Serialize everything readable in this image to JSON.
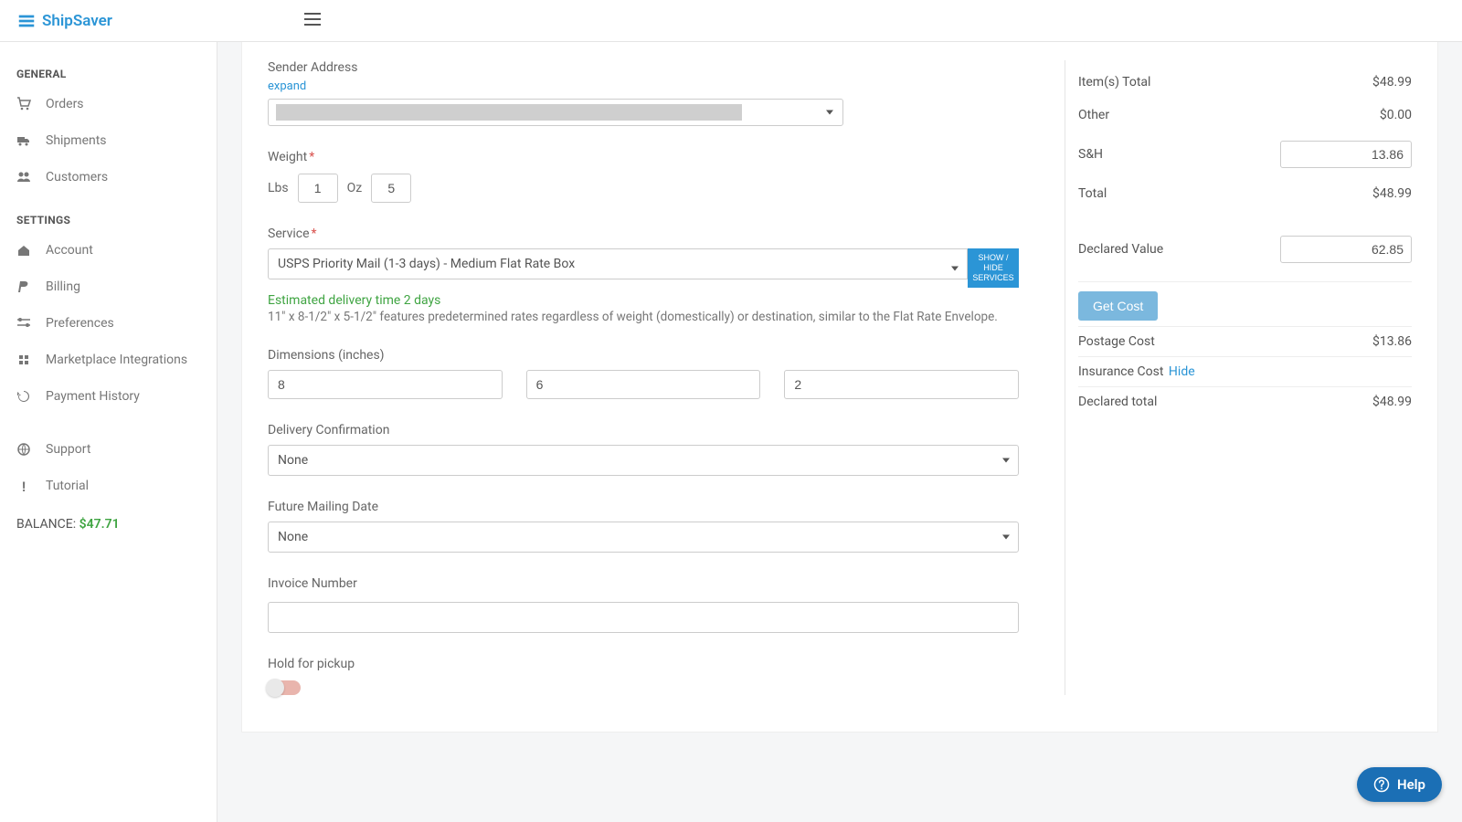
{
  "brand": "ShipSaver",
  "sidebar": {
    "general_heading": "GENERAL",
    "settings_heading": "SETTINGS",
    "items": {
      "orders": "Orders",
      "shipments": "Shipments",
      "customers": "Customers",
      "account": "Account",
      "billing": "Billing",
      "preferences": "Preferences",
      "integrations": "Marketplace Integrations",
      "payment_history": "Payment History",
      "support": "Support",
      "tutorial": "Tutorial"
    },
    "balance_label": "BALANCE:",
    "balance_amount": "$47.71"
  },
  "form": {
    "sender_label": "Sender Address",
    "expand": "expand",
    "weight_label": "Weight",
    "lbs_label": "Lbs",
    "oz_label": "Oz",
    "lbs_value": "1",
    "oz_value": "5",
    "service_label": "Service",
    "service_value": "USPS Priority Mail (1-3 days) - Medium Flat Rate Box",
    "show_hide": "SHOW / HIDE SERVICES",
    "est_time": "Estimated delivery time 2 days",
    "svc_desc": "11\" x 8-1/2\" x 5-1/2\" features predetermined rates regardless of weight (domestically) or destination, similar to the Flat Rate Envelope.",
    "dim_label": "Dimensions (inches)",
    "dim_l": "8",
    "dim_w": "6",
    "dim_h": "2",
    "delivery_conf_label": "Delivery Confirmation",
    "delivery_conf_value": "None",
    "future_label": "Future Mailing Date",
    "future_value": "None",
    "invoice_label": "Invoice Number",
    "invoice_value": "",
    "hold_label": "Hold for pickup"
  },
  "summary": {
    "items_total_label": "Item(s) Total",
    "items_total_value": "$48.99",
    "other_label": "Other",
    "other_value": "$0.00",
    "sh_label": "S&H",
    "sh_value": "13.86",
    "total_label": "Total",
    "total_value": "$48.99",
    "declared_label": "Declared Value",
    "declared_value": "62.85",
    "get_cost": "Get Cost",
    "postage_label": "Postage Cost",
    "postage_value": "$13.86",
    "insurance_label": "Insurance Cost",
    "hide": "Hide",
    "declared_total_label": "Declared total",
    "declared_total_value": "$48.99"
  },
  "help": "Help"
}
